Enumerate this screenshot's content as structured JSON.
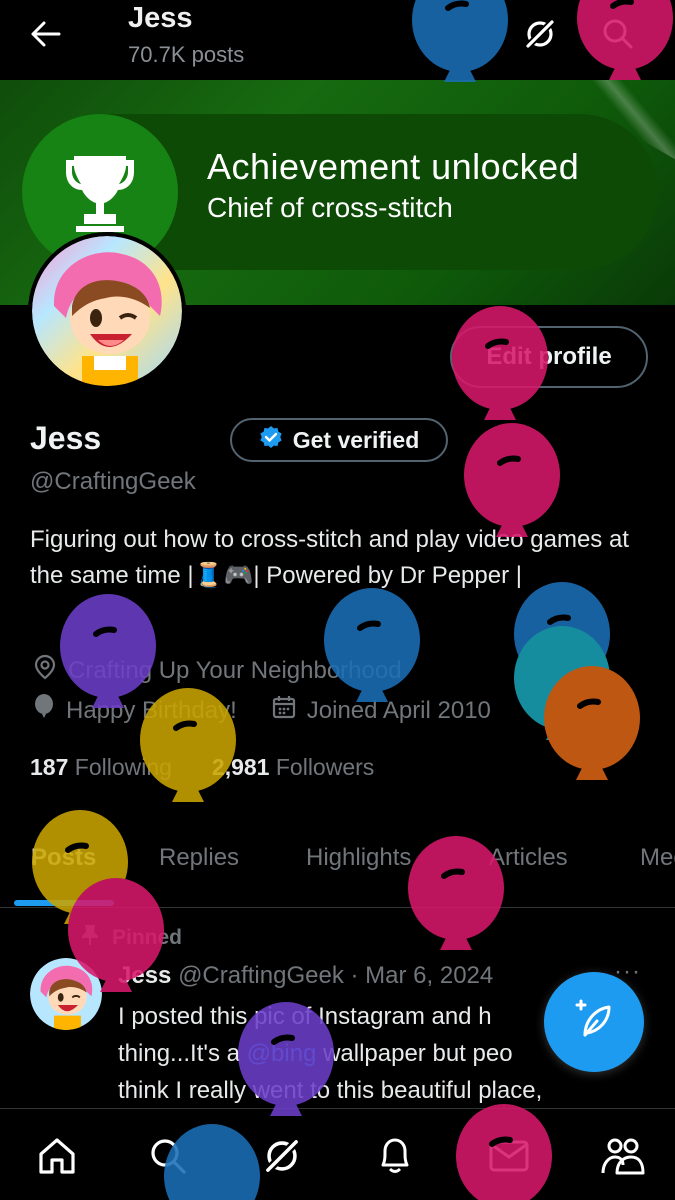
{
  "header": {
    "back_icon": "back-arrow-icon",
    "name": "Jess",
    "posts_count": "70.7K posts",
    "grok_icon": "grok-icon",
    "search_icon": "search-icon"
  },
  "banner": {
    "title": "Achievement unlocked",
    "subtitle": "Chief of cross-stitch",
    "icon": "trophy-icon",
    "colors": {
      "pill": "#0d4a06",
      "circle": "#178314"
    }
  },
  "profile": {
    "edit_label": "Edit profile",
    "display_name": "Jess",
    "get_verified_label": "Get verified",
    "handle": "@CraftingGeek",
    "bio": "Figuring out how to cross-stitch and play video games at the same time |🧵🎮| Powered by Dr Pepper |",
    "location": "Crafting Up Your Neighborhood",
    "birthday": "Happy Birthday!",
    "joined": "Joined April 2010",
    "following_count": "187",
    "following_label": "Following",
    "followers_count": "2,981",
    "followers_label": "Followers"
  },
  "tabs": [
    {
      "label": "Posts",
      "active": true
    },
    {
      "label": "Replies",
      "active": false
    },
    {
      "label": "Highlights",
      "active": false
    },
    {
      "label": "Articles",
      "active": false
    },
    {
      "label": "Media",
      "active": false
    }
  ],
  "post": {
    "pinned_label": "Pinned",
    "name": "Jess",
    "handle": "@CraftingGeek",
    "date": "Mar 6, 2024",
    "more": "···",
    "text_1": "I posted this pic of Instagram and h",
    "text_1b": "thing...It's a ",
    "mention": "@bing",
    "text_2": " wallpaper but peo",
    "text_3": "think I really went to this beautiful place,"
  },
  "fab_icon": "compose-post-icon",
  "bottom_nav": [
    "home-icon",
    "search-icon",
    "grok-icon",
    "notifications-icon",
    "messages-icon",
    "communities-icon"
  ],
  "accent": "#1d9bf0"
}
